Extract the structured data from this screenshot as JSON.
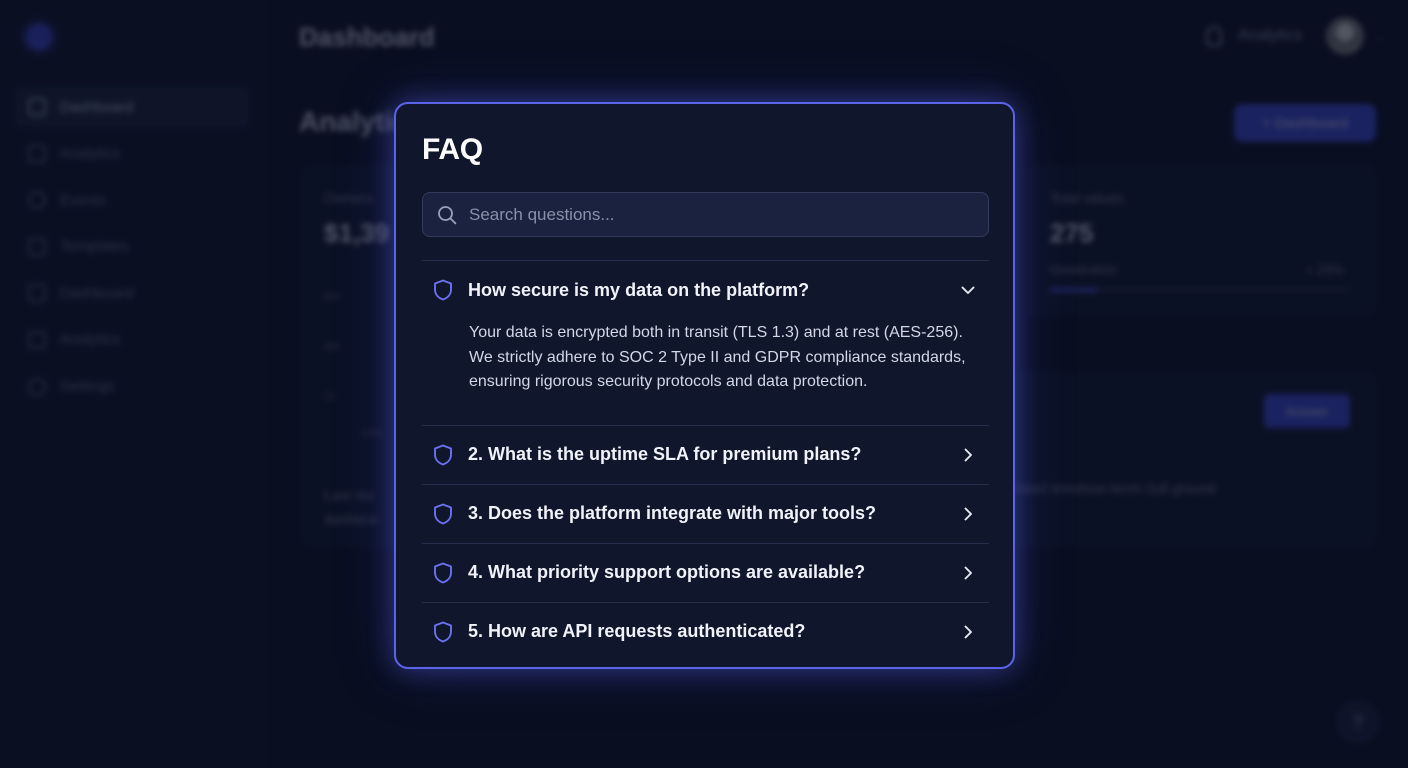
{
  "app": {
    "header": {
      "title": "Dashboard",
      "user_label": "Analytics"
    },
    "sidebar": {
      "items": [
        {
          "label": "Dashboard",
          "active": true
        },
        {
          "label": "Analytics"
        },
        {
          "label": "Events"
        },
        {
          "label": "Templates"
        },
        {
          "label": "Dashboard"
        },
        {
          "label": "Analytics"
        },
        {
          "label": "Settings"
        }
      ]
    },
    "page": {
      "heading": "Analytics",
      "action_button": "+ Dashboard"
    },
    "card_revenue": {
      "label": "Owners",
      "value": "$1,39",
      "ticks": [
        "90K",
        "40K",
        "75"
      ],
      "tick_x": "6.0%",
      "footer_lines": [
        "Last mo",
        "dashboa"
      ]
    },
    "card_total": {
      "label": "Total values",
      "value": "275",
      "sub_label": "Geastration",
      "sub_value": "+ 23%",
      "progress": 0.16
    },
    "card_events": {
      "button": "Answer",
      "text": "listed testshow-tenm t1dl ground"
    },
    "help": "?"
  },
  "modal": {
    "title": "FAQ",
    "search": {
      "placeholder": "Search questions..."
    },
    "items": [
      {
        "question": "How secure is my data on the platform?",
        "open": true,
        "answer": "Your data is encrypted both in transit (TLS 1.3) and at rest (AES-256). We strictly adhere to SOC 2 Type II and GDPR compliance standards, ensuring rigorous security protocols and data protection."
      },
      {
        "question": "2. What is the uptime SLA for premium plans?",
        "open": false
      },
      {
        "question": "3. Does the platform integrate with major tools?",
        "open": false
      },
      {
        "question": "4. What priority support options are available?",
        "open": false
      },
      {
        "question": "5. How are API requests authenticated?",
        "open": false
      }
    ],
    "icons": {
      "item": "shield-icon",
      "expanded": "chevron-down-icon",
      "collapsed": "chevron-right-icon"
    }
  },
  "colors": {
    "accent": "#5b63e8",
    "background": "#0c1226",
    "modal_bg": "#10162b",
    "shield": "#6a72f0"
  }
}
